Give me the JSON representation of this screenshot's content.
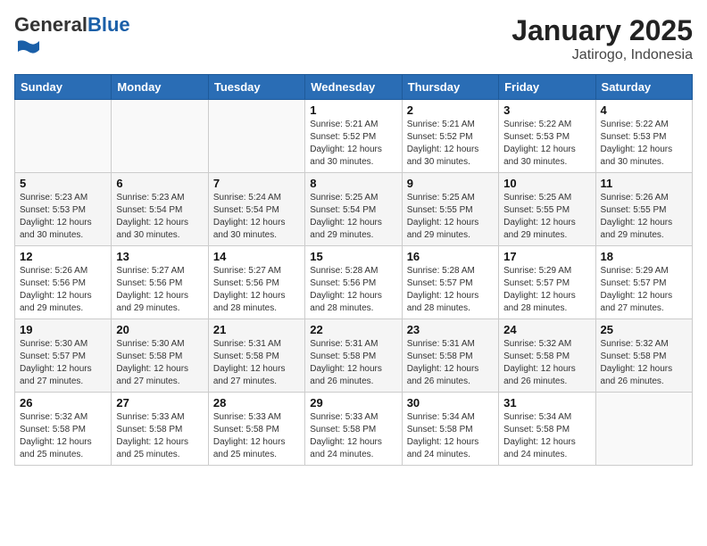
{
  "header": {
    "logo_general": "General",
    "logo_blue": "Blue",
    "title": "January 2025",
    "subtitle": "Jatirogo, Indonesia"
  },
  "weekdays": [
    "Sunday",
    "Monday",
    "Tuesday",
    "Wednesday",
    "Thursday",
    "Friday",
    "Saturday"
  ],
  "weeks": [
    [
      {
        "day": "",
        "text": ""
      },
      {
        "day": "",
        "text": ""
      },
      {
        "day": "",
        "text": ""
      },
      {
        "day": "1",
        "text": "Sunrise: 5:21 AM\nSunset: 5:52 PM\nDaylight: 12 hours\nand 30 minutes."
      },
      {
        "day": "2",
        "text": "Sunrise: 5:21 AM\nSunset: 5:52 PM\nDaylight: 12 hours\nand 30 minutes."
      },
      {
        "day": "3",
        "text": "Sunrise: 5:22 AM\nSunset: 5:53 PM\nDaylight: 12 hours\nand 30 minutes."
      },
      {
        "day": "4",
        "text": "Sunrise: 5:22 AM\nSunset: 5:53 PM\nDaylight: 12 hours\nand 30 minutes."
      }
    ],
    [
      {
        "day": "5",
        "text": "Sunrise: 5:23 AM\nSunset: 5:53 PM\nDaylight: 12 hours\nand 30 minutes."
      },
      {
        "day": "6",
        "text": "Sunrise: 5:23 AM\nSunset: 5:54 PM\nDaylight: 12 hours\nand 30 minutes."
      },
      {
        "day": "7",
        "text": "Sunrise: 5:24 AM\nSunset: 5:54 PM\nDaylight: 12 hours\nand 30 minutes."
      },
      {
        "day": "8",
        "text": "Sunrise: 5:25 AM\nSunset: 5:54 PM\nDaylight: 12 hours\nand 29 minutes."
      },
      {
        "day": "9",
        "text": "Sunrise: 5:25 AM\nSunset: 5:55 PM\nDaylight: 12 hours\nand 29 minutes."
      },
      {
        "day": "10",
        "text": "Sunrise: 5:25 AM\nSunset: 5:55 PM\nDaylight: 12 hours\nand 29 minutes."
      },
      {
        "day": "11",
        "text": "Sunrise: 5:26 AM\nSunset: 5:55 PM\nDaylight: 12 hours\nand 29 minutes."
      }
    ],
    [
      {
        "day": "12",
        "text": "Sunrise: 5:26 AM\nSunset: 5:56 PM\nDaylight: 12 hours\nand 29 minutes."
      },
      {
        "day": "13",
        "text": "Sunrise: 5:27 AM\nSunset: 5:56 PM\nDaylight: 12 hours\nand 29 minutes."
      },
      {
        "day": "14",
        "text": "Sunrise: 5:27 AM\nSunset: 5:56 PM\nDaylight: 12 hours\nand 28 minutes."
      },
      {
        "day": "15",
        "text": "Sunrise: 5:28 AM\nSunset: 5:56 PM\nDaylight: 12 hours\nand 28 minutes."
      },
      {
        "day": "16",
        "text": "Sunrise: 5:28 AM\nSunset: 5:57 PM\nDaylight: 12 hours\nand 28 minutes."
      },
      {
        "day": "17",
        "text": "Sunrise: 5:29 AM\nSunset: 5:57 PM\nDaylight: 12 hours\nand 28 minutes."
      },
      {
        "day": "18",
        "text": "Sunrise: 5:29 AM\nSunset: 5:57 PM\nDaylight: 12 hours\nand 27 minutes."
      }
    ],
    [
      {
        "day": "19",
        "text": "Sunrise: 5:30 AM\nSunset: 5:57 PM\nDaylight: 12 hours\nand 27 minutes."
      },
      {
        "day": "20",
        "text": "Sunrise: 5:30 AM\nSunset: 5:58 PM\nDaylight: 12 hours\nand 27 minutes."
      },
      {
        "day": "21",
        "text": "Sunrise: 5:31 AM\nSunset: 5:58 PM\nDaylight: 12 hours\nand 27 minutes."
      },
      {
        "day": "22",
        "text": "Sunrise: 5:31 AM\nSunset: 5:58 PM\nDaylight: 12 hours\nand 26 minutes."
      },
      {
        "day": "23",
        "text": "Sunrise: 5:31 AM\nSunset: 5:58 PM\nDaylight: 12 hours\nand 26 minutes."
      },
      {
        "day": "24",
        "text": "Sunrise: 5:32 AM\nSunset: 5:58 PM\nDaylight: 12 hours\nand 26 minutes."
      },
      {
        "day": "25",
        "text": "Sunrise: 5:32 AM\nSunset: 5:58 PM\nDaylight: 12 hours\nand 26 minutes."
      }
    ],
    [
      {
        "day": "26",
        "text": "Sunrise: 5:32 AM\nSunset: 5:58 PM\nDaylight: 12 hours\nand 25 minutes."
      },
      {
        "day": "27",
        "text": "Sunrise: 5:33 AM\nSunset: 5:58 PM\nDaylight: 12 hours\nand 25 minutes."
      },
      {
        "day": "28",
        "text": "Sunrise: 5:33 AM\nSunset: 5:58 PM\nDaylight: 12 hours\nand 25 minutes."
      },
      {
        "day": "29",
        "text": "Sunrise: 5:33 AM\nSunset: 5:58 PM\nDaylight: 12 hours\nand 24 minutes."
      },
      {
        "day": "30",
        "text": "Sunrise: 5:34 AM\nSunset: 5:58 PM\nDaylight: 12 hours\nand 24 minutes."
      },
      {
        "day": "31",
        "text": "Sunrise: 5:34 AM\nSunset: 5:58 PM\nDaylight: 12 hours\nand 24 minutes."
      },
      {
        "day": "",
        "text": ""
      }
    ]
  ]
}
